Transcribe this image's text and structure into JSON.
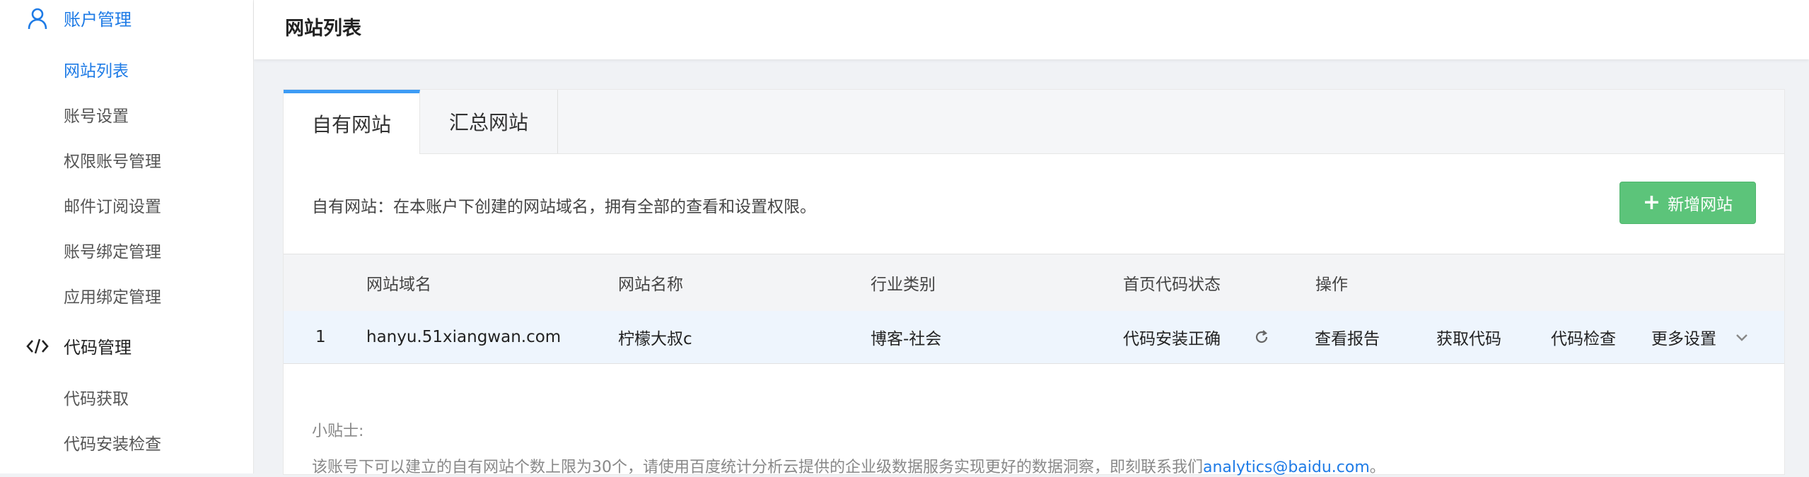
{
  "sidebar": {
    "account_group": {
      "label": "账户管理",
      "icon": "user-icon"
    },
    "account_items": [
      "网站列表",
      "账号设置",
      "权限账号管理",
      "邮件订阅设置",
      "账号绑定管理",
      "应用绑定管理"
    ],
    "code_group": {
      "label": "代码管理",
      "icon": "code-icon"
    },
    "code_items": [
      "代码获取",
      "代码安装检查"
    ]
  },
  "header": {
    "title": "网站列表"
  },
  "tabs": [
    {
      "label": "自有网站",
      "active": true
    },
    {
      "label": "汇总网站",
      "active": false
    }
  ],
  "main": {
    "description": "自有网站：在本账户下创建的网站域名，拥有全部的查看和设置权限。",
    "add_button": "新增网站"
  },
  "table": {
    "columns": [
      "网站域名",
      "网站名称",
      "行业类别",
      "首页代码状态",
      "操作"
    ],
    "rows": [
      {
        "index": "1",
        "domain": "hanyu.51xiangwan.com",
        "name": "柠檬大叔c",
        "category": "博客-社会",
        "status": "代码安装正确",
        "actions": [
          "查看报告",
          "获取代码",
          "代码检查",
          "更多设置"
        ]
      }
    ]
  },
  "tips": {
    "title": "小贴士:",
    "text": "该账号下可以建立的自有网站个数上限为30个，请使用百度统计分析云提供的企业级数据服务实现更好的数据洞察，即刻联系我们",
    "email": "analytics@baidu.com",
    "suffix": "。"
  },
  "colors": {
    "accent": "#1e7be6",
    "add_button": "#5cc47a",
    "tab_indicator": "#3d9cf5"
  }
}
